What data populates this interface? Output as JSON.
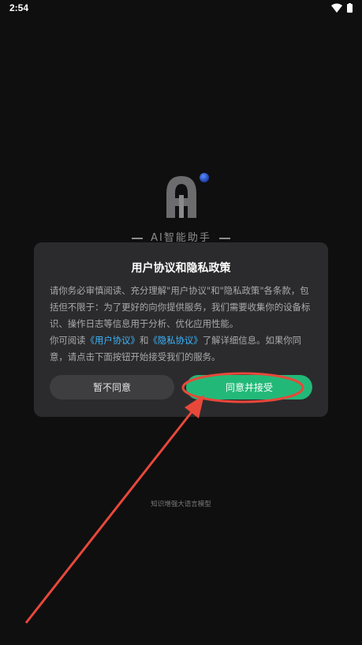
{
  "status_bar": {
    "time": "2:54"
  },
  "logo": {
    "tagline": "AI智能助手"
  },
  "dialog": {
    "title": "用户协议和隐私政策",
    "paragraph1": "请你务必审慎阅读、充分理解\"用户协议\"和\"隐私政策\"各条款，包括但不限于：为了更好的向你提供服务，我们需要收集你的设备标识、操作日志等信息用于分析、优化应用性能。",
    "paragraph2_prefix": "你可阅读",
    "link_user_agreement": "《用户协议》",
    "paragraph2_and": "和",
    "link_privacy_agreement": "《隐私协议》",
    "paragraph2_suffix": "了解详细信息。如果你同意，请点击下面按钮开始接受我们的服务。",
    "decline_label": "暂不同意",
    "accept_label": "同意并接受"
  },
  "footer": {
    "note": "知识增强大语言模型"
  },
  "colors": {
    "background": "#0f0f10",
    "dialog": "#2b2b2d",
    "accept": "#22b978",
    "link": "#3cb6ff",
    "annotation": "#e8483a"
  }
}
